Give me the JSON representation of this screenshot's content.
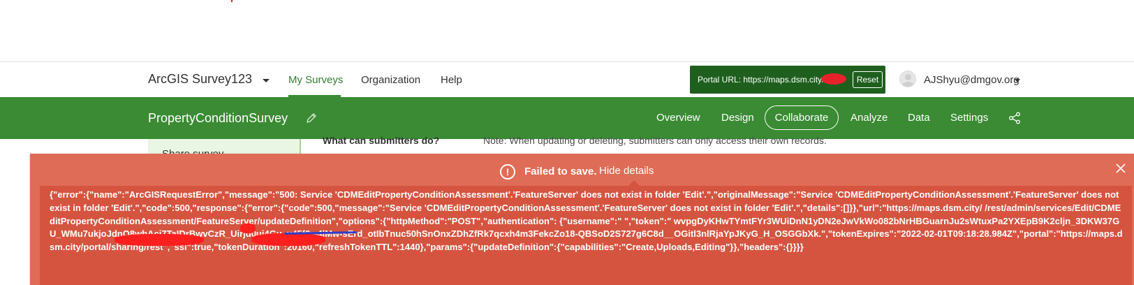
{
  "top_nav": {
    "app_title": "ArcGIS Survey123",
    "links": [
      {
        "label": "My Surveys",
        "active": true
      },
      {
        "label": "Organization",
        "active": false
      },
      {
        "label": "Help",
        "active": false
      }
    ],
    "portal": {
      "label": "Portal URL: https://maps.dsm.city/",
      "reset_label": "Reset"
    },
    "user": {
      "name": "AJShyu@dmgov.org"
    }
  },
  "survey_bar": {
    "survey_name": "PropertyConditionSurvey",
    "tabs": [
      "Overview",
      "Design",
      "Collaborate",
      "Analyze",
      "Data",
      "Settings"
    ],
    "active_tab": "Collaborate"
  },
  "content": {
    "sidebar_item": "Share survey",
    "question_label": "What can submitters do?",
    "question_note": "Note: When updating or deleting, submitters can only access their own records."
  },
  "error_banner": {
    "icon_glyph": "!",
    "title": "Failed to save.",
    "toggle_label": "Hide details",
    "details": "{\"error\":{\"name\":\"ArcGISRequestError\",\"message\":\"500: Service 'CDMEditPropertyConditionAssessment'.'FeatureServer' does not exist in folder 'Edit'.\",\"originalMessage\":\"Service 'CDMEditPropertyConditionAssessment'.'FeatureServer' does not exist in folder 'Edit'.\",\"code\":500,\"response\":{\"error\":{\"code\":500,\"message\":\"Service 'CDMEditPropertyConditionAssessment'.'FeatureServer' does not exist in folder 'Edit'.\",\"details\":[]}},\"url\":\"https://maps.dsm.city/ /rest/admin/services/Edit/CDMEditPropertyConditionAssessment/FeatureServer/updateDefinition\",\"options\":{\"httpMethod\":\"POST\",\"authentication\": {\"username\":\" \",\"token\":\" wvpgDyKHwTYmtFYr3WUiDnN1yDN2eJwVkWo082bNrHBGuarnJu2sWtuxPa2YXEpB9K2cljn_3DKW37GU_WMu7ukjoJdnO8wbAci7TaIDrBwvCzR_Uirjd0uj4Gu_v45f2w4lMw-sErd_otIbTnuc50hSnOnxZDhZfRk7qcxh4m3FekcZo18-QBSoD2S727g6C8d__OGitl3nlRjaYpJKyG_H_OSGGbXk.\",\"tokenExpires\":\"2022-02-01T09:18:28.984Z\",\"portal\":\"https://maps.dsm.city/portal/sharing/rest\",\"ssl\":true,\"tokenDuration\":20160,\"refreshTokenTTL\":1440},\"params\":{\"updateDefinition\":{\"capabilities\":\"Create,Uploads,Editing\"}},\"headers\":{}}}}"
  },
  "colors": {
    "brand_green": "#3a8b33",
    "portal_dark_green": "#1f5f1e",
    "error_bg": "#df6c56",
    "error_details_bg": "#d55440"
  }
}
